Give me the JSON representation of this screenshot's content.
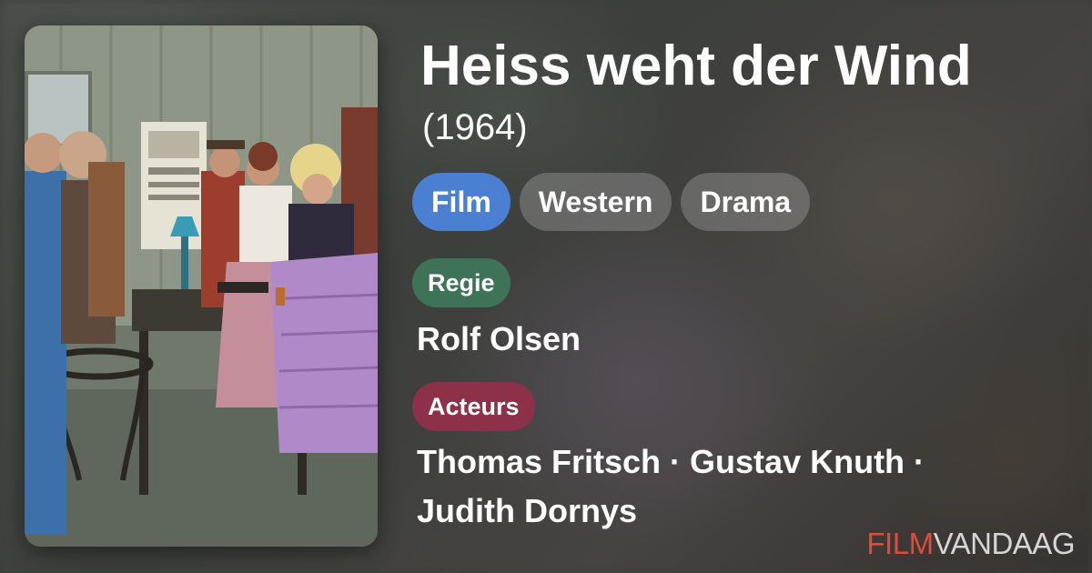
{
  "movie": {
    "title": "Heiss weht der Wind",
    "year": "(1964)",
    "genres": [
      "Film",
      "Western",
      "Drama"
    ],
    "director_label": "Regie",
    "director": "Rolf Olsen",
    "cast_label": "Acteurs",
    "cast_line1": "Thomas Fritsch · Gustav Knuth ·",
    "cast_line2": "Judith Dornys"
  },
  "brand": {
    "part1": "FILM",
    "part2": "VANDAAG"
  },
  "colors": {
    "primary_chip": "#4a7fd1",
    "regie_badge": "#3f7358",
    "acteurs_badge": "#8d3049",
    "brand_red": "#e14b3b"
  }
}
